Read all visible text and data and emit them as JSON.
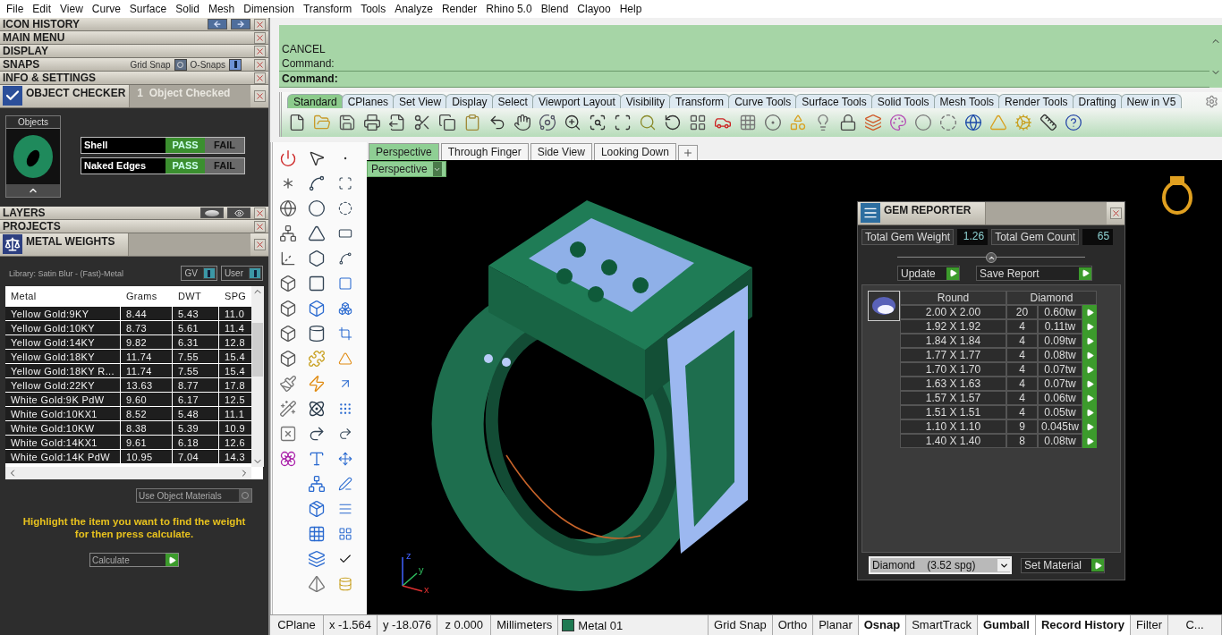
{
  "menu": [
    "File",
    "Edit",
    "View",
    "Curve",
    "Surface",
    "Solid",
    "Mesh",
    "Dimension",
    "Transform",
    "Tools",
    "Analyze",
    "Render",
    "Rhino 5.0",
    "Blend",
    "Clayoo",
    "Help"
  ],
  "panel_headers": [
    {
      "title": "ICON HISTORY",
      "kind": "history"
    },
    {
      "title": "MAIN MENU",
      "kind": "plain"
    },
    {
      "title": "DISPLAY",
      "kind": "plain"
    },
    {
      "title": "SNAPS",
      "kind": "snaps"
    },
    {
      "title": "INFO & SETTINGS",
      "kind": "plain"
    }
  ],
  "snaps": [
    {
      "label": "Grid Snap",
      "on": false
    },
    {
      "label": "O-Snaps",
      "on": true
    }
  ],
  "object_checker": {
    "title": "OBJECT CHECKER",
    "status": "1  Object Checked",
    "thumbnail_label": "Objects",
    "checks": [
      {
        "label": "Shell",
        "pass": "PASS",
        "fail": "FAIL",
        "passed": true
      },
      {
        "label": "Naked Edges",
        "pass": "PASS",
        "fail": "FAIL",
        "passed": true
      }
    ]
  },
  "lower_headers": [
    {
      "title": "LAYERS",
      "kind": "layers"
    },
    {
      "title": "PROJECTS",
      "kind": "plain"
    }
  ],
  "metal_weights": {
    "title": "METAL WEIGHTS",
    "library": "Library: Satin Blur - (Fast)-Metal",
    "toggles": [
      {
        "label": "GV",
        "on": true
      },
      {
        "label": "User",
        "on": true
      }
    ],
    "columns": [
      "Metal",
      "Grams",
      "DWT",
      "SPG"
    ],
    "rows": [
      [
        "Yellow Gold:9KY",
        "8.44",
        "5.43",
        "11.0"
      ],
      [
        "Yellow Gold:10KY",
        "8.73",
        "5.61",
        "11.4"
      ],
      [
        "Yellow Gold:14KY",
        "9.82",
        "6.31",
        "12.8"
      ],
      [
        "Yellow Gold:18KY",
        "11.74",
        "7.55",
        "15.4"
      ],
      [
        "Yellow Gold:18KY R...",
        "11.74",
        "7.55",
        "15.4"
      ],
      [
        "Yellow Gold:22KY",
        "13.63",
        "8.77",
        "17.8"
      ],
      [
        "White Gold:9K PdW",
        "9.60",
        "6.17",
        "12.5"
      ],
      [
        "White Gold:10KX1",
        "8.52",
        "5.48",
        "11.1"
      ],
      [
        "White Gold:10KW",
        "8.38",
        "5.39",
        "10.9"
      ],
      [
        "White Gold:14KX1",
        "9.61",
        "6.18",
        "12.6"
      ],
      [
        "White Gold:14K PdW",
        "10.95",
        "7.04",
        "14.3"
      ]
    ],
    "use_object_materials": {
      "label": "Use Object Materials",
      "checked": false
    },
    "hint": "Highlight the item you want to find the weight for then press calculate.",
    "calculate": "Calculate"
  },
  "command": {
    "history": [
      "CANCEL",
      "Command:"
    ],
    "prompt": "Command:"
  },
  "toolbar_tabs": [
    {
      "label": "Standard",
      "selected": true
    },
    {
      "label": "CPlanes",
      "selected": false
    },
    {
      "label": "Set View",
      "selected": false
    },
    {
      "label": "Display",
      "selected": false
    },
    {
      "label": "Select",
      "selected": false
    },
    {
      "label": "Viewport Layout",
      "selected": false
    },
    {
      "label": "Visibility",
      "selected": false
    },
    {
      "label": "Transform",
      "selected": false
    },
    {
      "label": "Curve Tools",
      "selected": false
    },
    {
      "label": "Surface Tools",
      "selected": false
    },
    {
      "label": "Solid Tools",
      "selected": false
    },
    {
      "label": "Mesh Tools",
      "selected": false
    },
    {
      "label": "Render Tools",
      "selected": false
    },
    {
      "label": "Drafting",
      "selected": false
    },
    {
      "label": "New in V5",
      "selected": false
    }
  ],
  "viewport_tabs": [
    {
      "label": "Perspective",
      "selected": true
    },
    {
      "label": "Through Finger",
      "selected": false
    },
    {
      "label": "Side View",
      "selected": false
    },
    {
      "label": "Looking Down",
      "selected": false
    }
  ],
  "viewport": {
    "label": "Perspective",
    "axis_labels": [
      "z",
      "y",
      "x"
    ]
  },
  "gem_reporter": {
    "title": "GEM REPORTER",
    "weight_label": "Total Gem Weight",
    "weight": "1.26",
    "count_label": "Total Gem Count",
    "count": "65",
    "update": "Update",
    "save_report": "Save Report",
    "columns": [
      "Round",
      "Diamond"
    ],
    "rows": [
      {
        "size": "2.00 X 2.00",
        "count": "20",
        "weight": "0.60tw"
      },
      {
        "size": "1.92 X 1.92",
        "count": "4",
        "weight": "0.11tw"
      },
      {
        "size": "1.84 X 1.84",
        "count": "4",
        "weight": "0.09tw"
      },
      {
        "size": "1.77 X 1.77",
        "count": "4",
        "weight": "0.08tw"
      },
      {
        "size": "1.70 X 1.70",
        "count": "4",
        "weight": "0.07tw"
      },
      {
        "size": "1.63 X 1.63",
        "count": "4",
        "weight": "0.07tw"
      },
      {
        "size": "1.57 X 1.57",
        "count": "4",
        "weight": "0.06tw"
      },
      {
        "size": "1.51 X 1.51",
        "count": "4",
        "weight": "0.05tw"
      },
      {
        "size": "1.10 X 1.10",
        "count": "9",
        "weight": "0.045tw"
      },
      {
        "size": "1.40 X 1.40",
        "count": "8",
        "weight": "0.08tw"
      }
    ],
    "material": "Diamond    (3.52 spg)",
    "set_material": "Set Material"
  },
  "status_bar": [
    {
      "text": "CPlane",
      "kind": "plain"
    },
    {
      "text": "x -1.564",
      "kind": "plain"
    },
    {
      "text": "y -18.076",
      "kind": "plain"
    },
    {
      "text": "z 0.000",
      "kind": "plain"
    },
    {
      "text": "Millimeters",
      "kind": "plain"
    },
    {
      "text": "Metal 01",
      "kind": "layer",
      "color": "#1e7a52"
    },
    {
      "text": "Grid Snap",
      "kind": "toggle",
      "on": false
    },
    {
      "text": "Ortho",
      "kind": "toggle",
      "on": false
    },
    {
      "text": "Planar",
      "kind": "toggle",
      "on": false
    },
    {
      "text": "Osnap",
      "kind": "toggle",
      "on": true
    },
    {
      "text": "SmartTrack",
      "kind": "toggle",
      "on": false
    },
    {
      "text": "Gumball",
      "kind": "toggle",
      "on": true
    },
    {
      "text": "Record History",
      "kind": "toggle",
      "on": true
    },
    {
      "text": "Filter",
      "kind": "toggle",
      "on": false
    },
    {
      "text": "C...",
      "kind": "plain"
    }
  ]
}
